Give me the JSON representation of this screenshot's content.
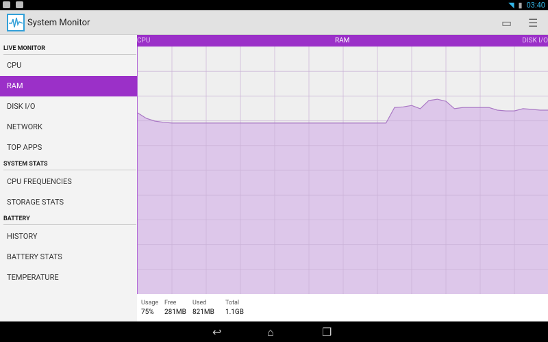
{
  "status_bar": {
    "time": "03:40",
    "icons": [
      "image-notification-icon",
      "android-notification-icon",
      "wifi-icon",
      "battery-icon"
    ]
  },
  "app": {
    "title": "System Monitor",
    "actions": [
      "display-icon",
      "settings-sliders-icon"
    ]
  },
  "sidebar": {
    "sections": [
      {
        "label": "LIVE MONITOR",
        "items": [
          {
            "label": "CPU"
          },
          {
            "label": "RAM",
            "selected": true
          },
          {
            "label": "DISK I/O"
          },
          {
            "label": "NETWORK"
          },
          {
            "label": "TOP APPS"
          }
        ]
      },
      {
        "label": "SYSTEM STATS",
        "items": [
          {
            "label": "CPU FREQUENCIES"
          },
          {
            "label": "STORAGE STATS"
          }
        ]
      },
      {
        "label": "BATTERY",
        "items": [
          {
            "label": "HISTORY"
          },
          {
            "label": "BATTERY STATS"
          },
          {
            "label": "TEMPERATURE"
          }
        ]
      }
    ]
  },
  "chart_header": {
    "prev": "CPU",
    "current": "RAM",
    "next": "DISK I/O"
  },
  "chart_data": {
    "type": "area",
    "ylim": [
      0,
      100
    ],
    "grid": true,
    "color": "#9b30c8",
    "series": [
      {
        "values": [
          73.2,
          71,
          69.9,
          69.4,
          69.1,
          69.1,
          69.1,
          69.1,
          69.1,
          69.1,
          69.1,
          69.1,
          69.1,
          69.1,
          69.1,
          69.1,
          69.1,
          69.1,
          69.1,
          69.1,
          69.1,
          69.1,
          69.1,
          69.1,
          69.1,
          69.1,
          69.1,
          69.1,
          69.1,
          69.1,
          75.4,
          75.6,
          76.2,
          74.9,
          78.2,
          78.7,
          77.9,
          74.9,
          75.4,
          75.4,
          75.4,
          75.4,
          74.3,
          74.0,
          74.0,
          74.9,
          74.6,
          74.3,
          74.3
        ]
      }
    ]
  },
  "stats": [
    {
      "label": "Usage",
      "value": "75%"
    },
    {
      "label": "Free",
      "value": "281MB"
    },
    {
      "label": "Used",
      "value": "821MB"
    },
    {
      "label": "Total",
      "value": "1.1GB"
    }
  ],
  "navbar": [
    "back-icon",
    "home-icon",
    "recents-icon"
  ]
}
